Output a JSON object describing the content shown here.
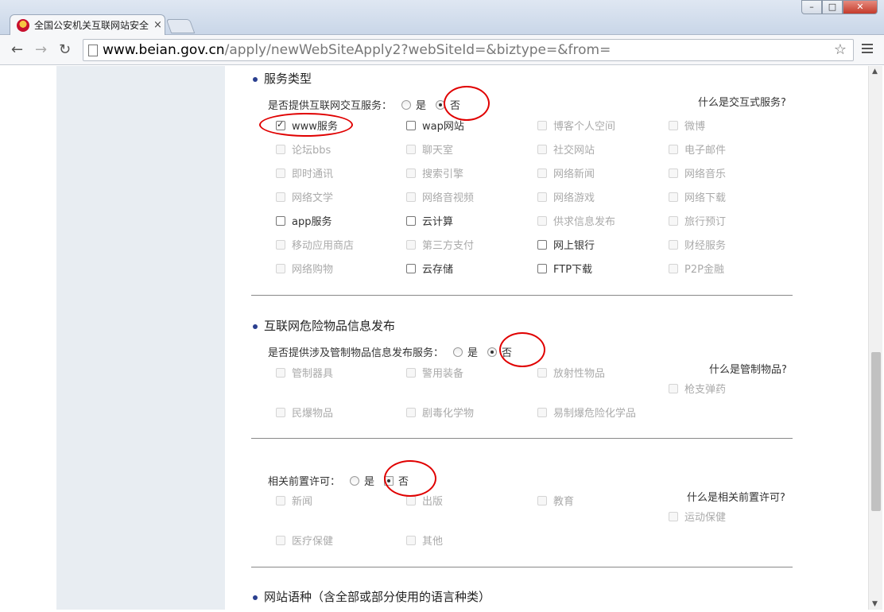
{
  "browser": {
    "tab_title": "全国公安机关互联网站安全",
    "tab_close": "×",
    "url_domain": "www.beian.gov.cn",
    "url_path": "/apply/newWebSiteApply2?webSiteId=&biztype=&from=",
    "back": "←",
    "forward": "→",
    "reload": "↻",
    "star": "☆",
    "window_min": "–",
    "window_max": "□",
    "window_close": "✕"
  },
  "service_type": {
    "title": "服务类型",
    "question": "是否提供互联网交互服务：",
    "yes_label": "是",
    "no_label": "否",
    "selected": "否",
    "help_link": "什么是交互式服务?",
    "items": [
      {
        "label": "www服务",
        "enabled": true,
        "checked": true
      },
      {
        "label": "wap网站",
        "enabled": true,
        "checked": false
      },
      {
        "label": "博客个人空间",
        "enabled": false,
        "checked": false
      },
      {
        "label": "微博",
        "enabled": false,
        "checked": false
      },
      {
        "label": "论坛bbs",
        "enabled": false,
        "checked": false
      },
      {
        "label": "聊天室",
        "enabled": false,
        "checked": false
      },
      {
        "label": "社交网站",
        "enabled": false,
        "checked": false
      },
      {
        "label": "电子邮件",
        "enabled": false,
        "checked": false
      },
      {
        "label": "即时通讯",
        "enabled": false,
        "checked": false
      },
      {
        "label": "搜索引擎",
        "enabled": false,
        "checked": false
      },
      {
        "label": "网络新闻",
        "enabled": false,
        "checked": false
      },
      {
        "label": "网络音乐",
        "enabled": false,
        "checked": false
      },
      {
        "label": "网络文学",
        "enabled": false,
        "checked": false
      },
      {
        "label": "网络音视频",
        "enabled": false,
        "checked": false
      },
      {
        "label": "网络游戏",
        "enabled": false,
        "checked": false
      },
      {
        "label": "网络下载",
        "enabled": false,
        "checked": false
      },
      {
        "label": "app服务",
        "enabled": true,
        "checked": false
      },
      {
        "label": "云计算",
        "enabled": true,
        "checked": false
      },
      {
        "label": "供求信息发布",
        "enabled": false,
        "checked": false
      },
      {
        "label": "旅行预订",
        "enabled": false,
        "checked": false
      },
      {
        "label": "移动应用商店",
        "enabled": false,
        "checked": false
      },
      {
        "label": "第三方支付",
        "enabled": false,
        "checked": false
      },
      {
        "label": "网上银行",
        "enabled": true,
        "checked": false
      },
      {
        "label": "财经服务",
        "enabled": false,
        "checked": false
      },
      {
        "label": "网络购物",
        "enabled": false,
        "checked": false
      },
      {
        "label": "云存储",
        "enabled": true,
        "checked": false
      },
      {
        "label": "FTP下载",
        "enabled": true,
        "checked": false
      },
      {
        "label": "P2P金融",
        "enabled": false,
        "checked": false
      }
    ]
  },
  "dangerous_goods": {
    "title": "互联网危险物品信息发布",
    "question": "是否提供涉及管制物品信息发布服务：",
    "yes_label": "是",
    "no_label": "否",
    "selected": "否",
    "help_link": "什么是管制物品?",
    "items": [
      "管制器具",
      "警用装备",
      "放射性物品",
      "枪支弹药",
      "民爆物品",
      "剧毒化学物",
      "易制爆危险化学品"
    ]
  },
  "permits": {
    "question": "相关前置许可：",
    "yes_label": "是",
    "no_label": "否",
    "selected": "否",
    "help_link": "什么是相关前置许可?",
    "items": [
      "新闻",
      "出版",
      "教育",
      "运动保健",
      "医疗保健",
      "其他"
    ]
  },
  "language": {
    "title": "网站语种（含全部或部分使用的语言种类）"
  },
  "annotation_color": "#e00000"
}
